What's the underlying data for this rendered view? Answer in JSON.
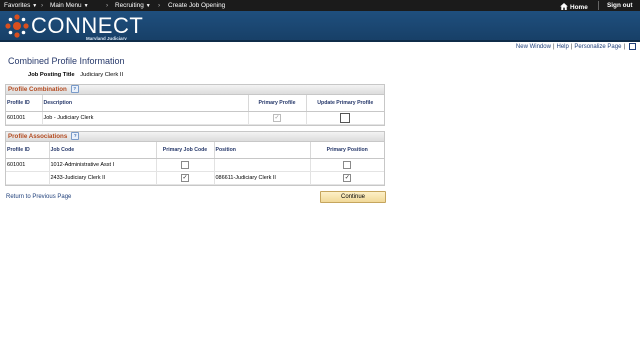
{
  "topnav": {
    "favorites": "Favorites",
    "main_menu": "Main Menu",
    "breadcrumb": [
      "Recruiting",
      "Create Job Opening"
    ],
    "home": "Home",
    "sign_out": "Sign out"
  },
  "brand": {
    "name": "CONNECT",
    "subtitle": "Maryland Judiciary",
    "colors": {
      "banner": "#1f4f7e",
      "accent": "#d94f1e",
      "link": "#1f3f7a"
    }
  },
  "util_links": {
    "new_window": "New Window",
    "help": "Help",
    "personalize": "Personalize Page"
  },
  "page": {
    "title": "Combined Profile Information",
    "posting_label": "Job Posting Title",
    "posting_value": "Judiciary Clerk II"
  },
  "profile_combination": {
    "title": "Profile Combination",
    "columns": [
      "Profile ID",
      "Description",
      "Primary Profile",
      "Update Primary Profile"
    ],
    "rows": [
      {
        "profile_id": "601001",
        "description": "Job - Judiciary Clerk",
        "primary_profile": true,
        "update_primary_profile": false
      }
    ]
  },
  "profile_associations": {
    "title": "Profile Associations",
    "columns": [
      "Profile ID",
      "Job Code",
      "Primary Job Code",
      "Position",
      "Primary Position"
    ],
    "rows": [
      {
        "profile_id": "601001",
        "job_code": "1012-Administrative Asst I",
        "primary_job_code": false,
        "position": "",
        "primary_position": false
      },
      {
        "profile_id": "",
        "job_code": "2433-Judiciary Clerk II",
        "primary_job_code": true,
        "position": "086611-Judiciary Clerk II",
        "primary_position": true
      }
    ]
  },
  "footer": {
    "return_link": "Return to Previous Page",
    "continue_button": "Continue"
  },
  "icons": [
    "dropdown-caret-icon",
    "home-icon",
    "help-icon",
    "checkbox-icon",
    "logo-mark-icon"
  ]
}
